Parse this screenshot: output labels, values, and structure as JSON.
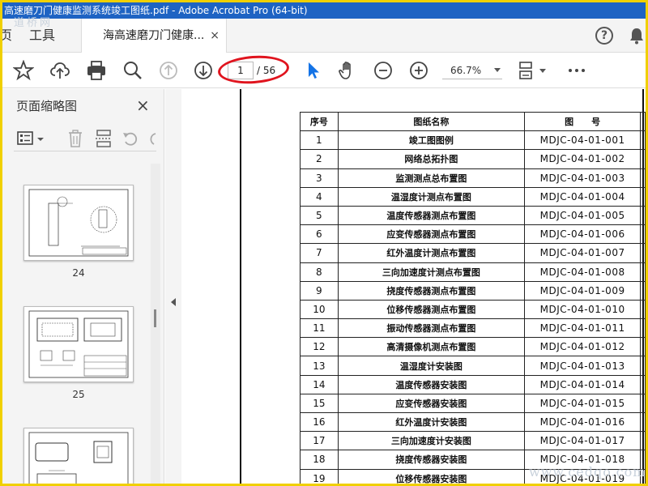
{
  "window": {
    "title": "高速磨刀门健康监测系统竣工图纸.pdf - Adobe Acrobat Pro (64-bit)"
  },
  "watermark": {
    "top": "道桥网",
    "bottom": "www.cedqo.com"
  },
  "menu": {
    "home_partial": "页",
    "tools": "工具",
    "help_glyph": "?"
  },
  "tab": {
    "title": "海高速磨刀门健康...",
    "close": "×"
  },
  "toolbar": {
    "current_page": "1",
    "total_pages": "/ 56",
    "zoom": "66.7%"
  },
  "panel": {
    "title": "页面缩略图",
    "close": "×"
  },
  "thumbnails": [
    {
      "label": "24"
    },
    {
      "label": "25"
    },
    {
      "label": ""
    }
  ],
  "table": {
    "headers": [
      "序号",
      "图纸名称",
      "图　　号"
    ],
    "rows": [
      [
        "1",
        "竣工图图例",
        "MDJC-04-01-001"
      ],
      [
        "2",
        "网络总拓扑图",
        "MDJC-04-01-002"
      ],
      [
        "3",
        "监测测点总布置图",
        "MDJC-04-01-003"
      ],
      [
        "4",
        "温湿度计测点布置图",
        "MDJC-04-01-004"
      ],
      [
        "5",
        "温度传感器测点布置图",
        "MDJC-04-01-005"
      ],
      [
        "6",
        "应变传感器测点布置图",
        "MDJC-04-01-006"
      ],
      [
        "7",
        "红外温度计测点布置图",
        "MDJC-04-01-007"
      ],
      [
        "8",
        "三向加速度计测点布置图",
        "MDJC-04-01-008"
      ],
      [
        "9",
        "挠度传感器测点布置图",
        "MDJC-04-01-009"
      ],
      [
        "10",
        "位移传感器测点布置图",
        "MDJC-04-01-010"
      ],
      [
        "11",
        "振动传感器测点布置图",
        "MDJC-04-01-011"
      ],
      [
        "12",
        "高清摄像机测点布置图",
        "MDJC-04-01-012"
      ],
      [
        "13",
        "温湿度计安装图",
        "MDJC-04-01-013"
      ],
      [
        "14",
        "温度传感器安装图",
        "MDJC-04-01-014"
      ],
      [
        "15",
        "应变传感器安装图",
        "MDJC-04-01-015"
      ],
      [
        "16",
        "红外温度计安装图",
        "MDJC-04-01-016"
      ],
      [
        "17",
        "三向加速度计安装图",
        "MDJC-04-01-017"
      ],
      [
        "18",
        "挠度传感器安装图",
        "MDJC-04-01-018"
      ],
      [
        "19",
        "位移传感器安装图",
        "MDJC-04-01-019"
      ]
    ]
  }
}
